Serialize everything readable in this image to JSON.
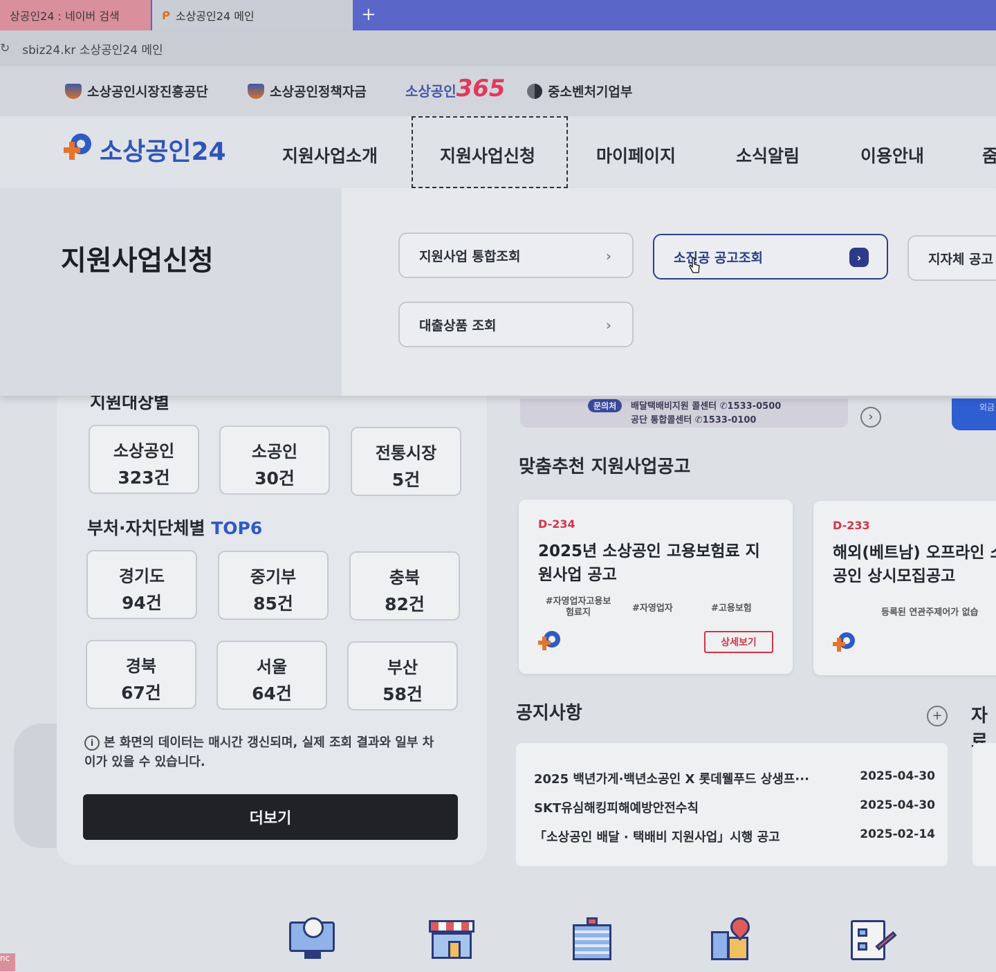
{
  "browser": {
    "tabs": [
      {
        "label": "상공인24 : 네이버 검색"
      },
      {
        "label": "소상공인24 메인"
      }
    ],
    "new_tab": "+",
    "address": "sbiz24.kr 소상공인24 메인",
    "reload": "↻"
  },
  "toplinks": {
    "items": [
      "소상공인시장진흥공단",
      "소상공인정책자금",
      "중소벤처기업부"
    ],
    "logo365_text": "소상공인",
    "logo365_num": "365"
  },
  "header": {
    "brand": "소상공인24",
    "menu": [
      "지원사업소개",
      "지원사업신청",
      "마이페이지",
      "소식알림",
      "이용안내",
      "줌"
    ]
  },
  "mega": {
    "title": "지원사업신청",
    "items": [
      {
        "label": "지원사업 통합조회",
        "chev": "›"
      },
      {
        "label": "소진공 공고조회",
        "chev": "›"
      },
      {
        "label": "지자체 공고"
      },
      {
        "label": "대출상품 조회",
        "chev": "›"
      }
    ]
  },
  "left": {
    "target_heading": "지원대상별",
    "targets": [
      {
        "name": "소상공인",
        "count": "323건"
      },
      {
        "name": "소공인",
        "count": "30건"
      },
      {
        "name": "전통시장",
        "count": "5건"
      }
    ],
    "region_heading": "부처·자치단체별",
    "region_highlight": "TOP6",
    "regions": [
      {
        "name": "경기도",
        "count": "94건"
      },
      {
        "name": "중기부",
        "count": "85건"
      },
      {
        "name": "충북",
        "count": "82건"
      },
      {
        "name": "경북",
        "count": "67건"
      },
      {
        "name": "서울",
        "count": "64건"
      },
      {
        "name": "부산",
        "count": "58건"
      }
    ],
    "note_icon": "i",
    "note": "본 화면의 데이터는 매시간 갱신되며, 실제 조회 결과와 일부 차이가 있을 수 있습니다.",
    "more_button": "더보기"
  },
  "contact": {
    "pill": "문의처",
    "line1": "배달택배비지원 콜센터 ✆1533-0500",
    "line2": "공단 통합콜센터 ✆1533-0100",
    "blue_tab": "외금"
  },
  "recommend": {
    "heading": "맞춤추천 지원사업공고",
    "cards": [
      {
        "dday": "D-234",
        "title": "2025년 소상공인 고용보험료 지원사업 공고",
        "tags": [
          "#자영업자고용보험료지",
          "#자영업자",
          "#고용보험"
        ],
        "detail": "상세보기"
      },
      {
        "dday": "D-233",
        "title": "해외(베트남) 오프라인 소공인 상시모집공고",
        "sub": "등록된 연관주제어가 없습"
      }
    ]
  },
  "notice": {
    "heading": "공지사항",
    "plus": "+",
    "extra": "자료",
    "rows": [
      {
        "title": "2025 백년가게·백년소공인 X 롯데웰푸드 상생프···",
        "date": "2025-04-30"
      },
      {
        "title": "SKT유심해킹피해예방안전수칙",
        "date": "2025-04-30"
      },
      {
        "title": "「소상공인 배달 · 택배비 지원사업」시행 공고",
        "date": "2025-02-14"
      }
    ]
  },
  "colors": {
    "brand_blue": "#2f5bc4",
    "brand_orange": "#e8732a",
    "dday_red": "#d2344a",
    "highlight": "#2f58c9"
  },
  "icons": [
    "monitor-clock-icon",
    "store-icon",
    "building-icon",
    "city-location-icon",
    "profile-document-icon"
  ]
}
